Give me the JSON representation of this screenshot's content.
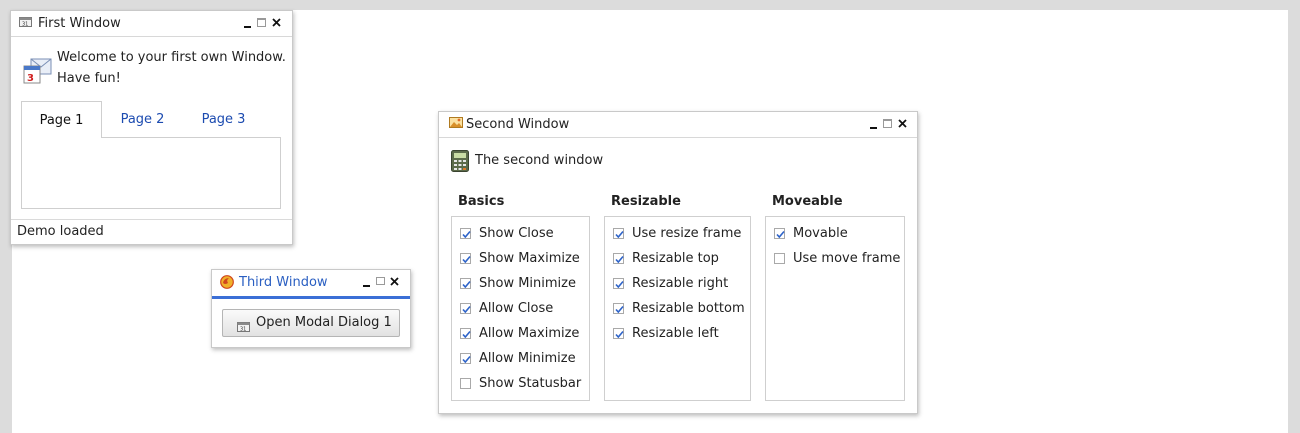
{
  "windows": {
    "first": {
      "title": "First Window",
      "welcome_line1": "Welcome to your first own Window.",
      "welcome_line2": "Have fun!",
      "tabs": [
        {
          "label": "Page 1",
          "active": true
        },
        {
          "label": "Page 2",
          "active": false
        },
        {
          "label": "Page 3",
          "active": false
        }
      ],
      "status": "Demo loaded",
      "icons": {
        "title": "calendar-icon",
        "body": "calendar-mail-icon"
      }
    },
    "second": {
      "title": "Second Window",
      "lead": "The second window",
      "icons": {
        "title": "picture-icon",
        "body": "calculator-icon"
      },
      "groups": [
        {
          "title": "Basics",
          "options": [
            {
              "label": "Show Close",
              "checked": true
            },
            {
              "label": "Show Maximize",
              "checked": true
            },
            {
              "label": "Show Minimize",
              "checked": true
            },
            {
              "label": "Allow Close",
              "checked": true
            },
            {
              "label": "Allow Maximize",
              "checked": true
            },
            {
              "label": "Allow Minimize",
              "checked": true
            },
            {
              "label": "Show Statusbar",
              "checked": false
            }
          ]
        },
        {
          "title": "Resizable",
          "options": [
            {
              "label": "Use resize frame",
              "checked": true
            },
            {
              "label": "Resizable top",
              "checked": true
            },
            {
              "label": "Resizable right",
              "checked": true
            },
            {
              "label": "Resizable bottom",
              "checked": true
            },
            {
              "label": "Resizable left",
              "checked": true
            }
          ]
        },
        {
          "title": "Moveable",
          "options": [
            {
              "label": "Movable",
              "checked": true
            },
            {
              "label": "Use move frame",
              "checked": false
            }
          ]
        }
      ]
    },
    "third": {
      "title": "Third Window",
      "button_label": "Open Modal Dialog 1",
      "icons": {
        "title": "firefox-icon",
        "button": "calendar-icon"
      }
    }
  },
  "colors": {
    "active_caption": "#3b6fd6",
    "link_blue": "#1c4bb0",
    "check_blue": "#2d63c9"
  }
}
